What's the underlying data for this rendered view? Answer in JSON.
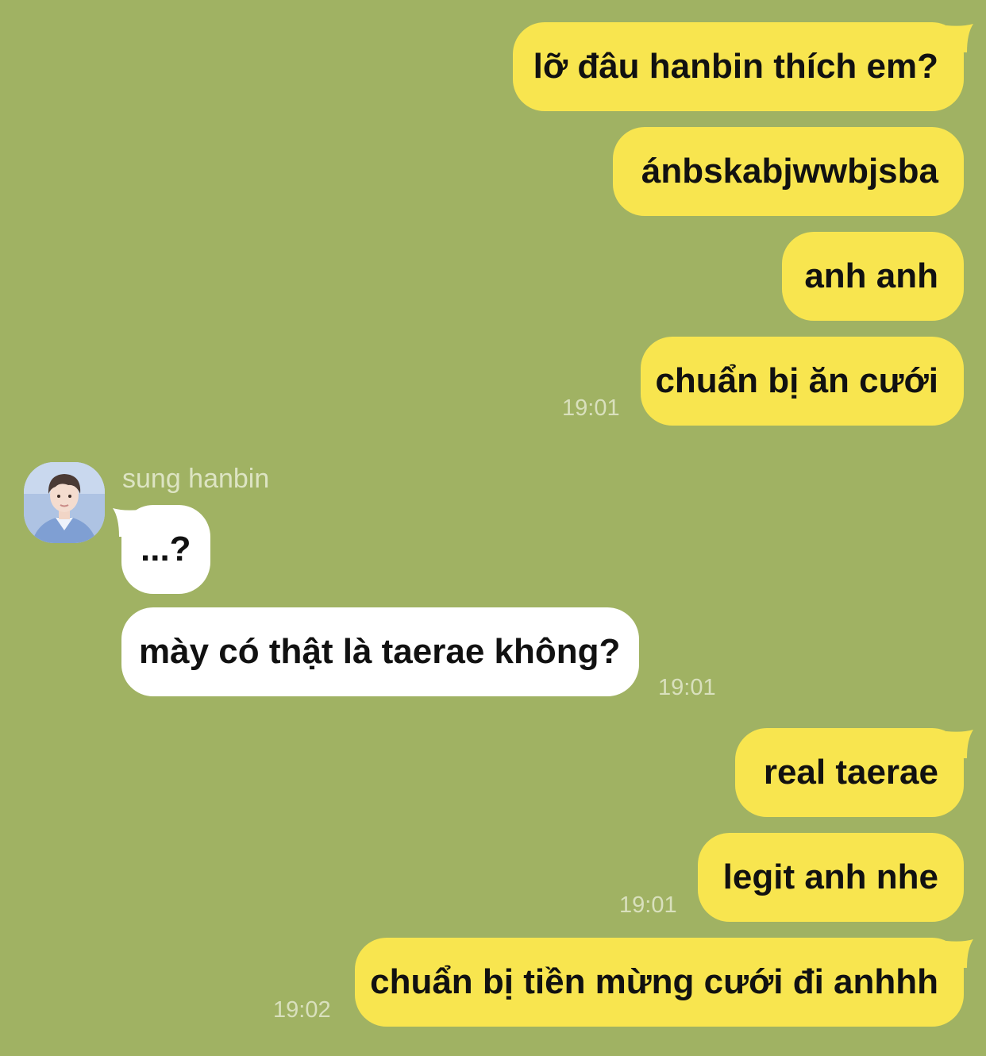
{
  "sender": {
    "name": "sung hanbin",
    "avatar": "avatar-photo"
  },
  "colors": {
    "background": "#a0b263",
    "outgoing_bubble": "#f8e54f",
    "incoming_bubble": "#ffffff",
    "timestamp": "#d9e0bd"
  },
  "messages": [
    {
      "direction": "out",
      "text": "lỡ đâu hanbin thích em?"
    },
    {
      "direction": "out",
      "text": "ánbskabjwwbjsba"
    },
    {
      "direction": "out",
      "text": "anh anh"
    },
    {
      "direction": "out",
      "text": "chuẩn bị ăn cưới",
      "time": "19:01"
    },
    {
      "direction": "in",
      "text": "...?"
    },
    {
      "direction": "in",
      "text": "mày có thật là taerae không?",
      "time": "19:01"
    },
    {
      "direction": "out",
      "text": "real taerae"
    },
    {
      "direction": "out",
      "text": "legit anh nhe",
      "time": "19:01"
    },
    {
      "direction": "out",
      "text": "chuẩn bị tiền mừng cưới đi anhhh",
      "time": "19:02"
    }
  ]
}
